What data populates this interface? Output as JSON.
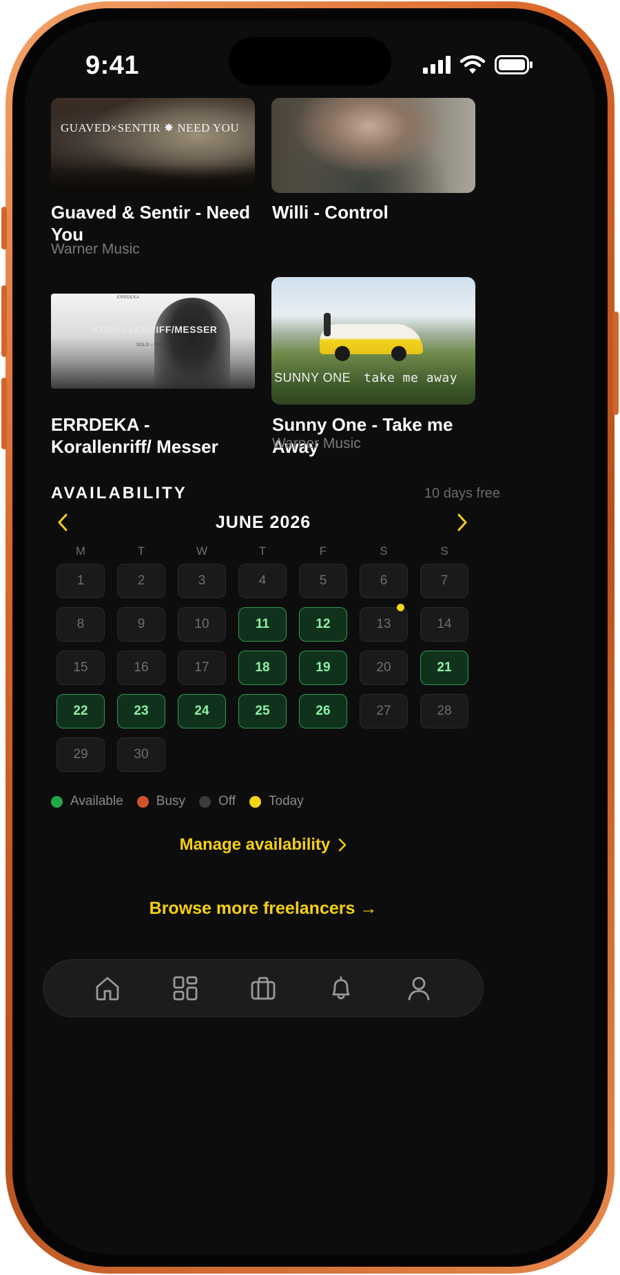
{
  "status_bar": {
    "time": "9:41"
  },
  "media": [
    {
      "title": "Guaved & Sentir - Need You",
      "subtitle": "Warner Music",
      "thumb_text": "GUAVED×SENTIR ✸ NEED YOU"
    },
    {
      "title": "Willi - Control",
      "subtitle": ""
    },
    {
      "title": "ERRDEKA - Korallenriff/ Messer",
      "subtitle": "",
      "thumb_text": "KORALLENRIFF/MESSER",
      "thumb_small_top": "ERRDEKA",
      "thumb_small_mid": "SOLO – PHASE I"
    },
    {
      "title": "Sunny One - Take me Away",
      "subtitle": "Warner Music",
      "thumb_text_left": "SUNNY ONE",
      "thumb_text_right": "take me away"
    }
  ],
  "availability": {
    "title": "AVAILABILITY",
    "free_text": "10 days free",
    "month": "JUNE 2026",
    "weekdays": [
      "M",
      "T",
      "W",
      "T",
      "F",
      "S",
      "S"
    ],
    "days": [
      {
        "d": "1",
        "status": "off"
      },
      {
        "d": "2",
        "status": "off"
      },
      {
        "d": "3",
        "status": "off"
      },
      {
        "d": "4",
        "status": "off"
      },
      {
        "d": "5",
        "status": "off"
      },
      {
        "d": "6",
        "status": "off"
      },
      {
        "d": "7",
        "status": "off"
      },
      {
        "d": "8",
        "status": "off"
      },
      {
        "d": "9",
        "status": "off"
      },
      {
        "d": "10",
        "status": "off"
      },
      {
        "d": "11",
        "status": "available"
      },
      {
        "d": "12",
        "status": "available"
      },
      {
        "d": "13",
        "status": "off",
        "today": true
      },
      {
        "d": "14",
        "status": "off"
      },
      {
        "d": "15",
        "status": "off"
      },
      {
        "d": "16",
        "status": "off"
      },
      {
        "d": "17",
        "status": "off"
      },
      {
        "d": "18",
        "status": "available"
      },
      {
        "d": "19",
        "status": "available"
      },
      {
        "d": "20",
        "status": "off"
      },
      {
        "d": "21",
        "status": "available"
      },
      {
        "d": "22",
        "status": "available"
      },
      {
        "d": "23",
        "status": "available"
      },
      {
        "d": "24",
        "status": "available"
      },
      {
        "d": "25",
        "status": "available"
      },
      {
        "d": "26",
        "status": "available"
      },
      {
        "d": "27",
        "status": "off"
      },
      {
        "d": "28",
        "status": "off"
      },
      {
        "d": "29",
        "status": "off"
      },
      {
        "d": "30",
        "status": "off"
      }
    ],
    "legend": [
      {
        "label": "Available",
        "color": "#22a84a"
      },
      {
        "label": "Busy",
        "color": "#d1532c"
      },
      {
        "label": "Off",
        "color": "#3a3a3a"
      },
      {
        "label": "Today",
        "color": "#f5d50f"
      }
    ]
  },
  "links": {
    "manage": "Manage availability",
    "browse": "Browse more freelancers →"
  },
  "tabbar": {
    "icons": [
      "home-icon",
      "grid-icon",
      "briefcase-icon",
      "bell-icon",
      "profile-icon"
    ]
  },
  "colors": {
    "accent": "#f5d00f",
    "available_bg": "#10321c",
    "available_border": "#2f9a4f",
    "background": "#0d0d0d"
  }
}
